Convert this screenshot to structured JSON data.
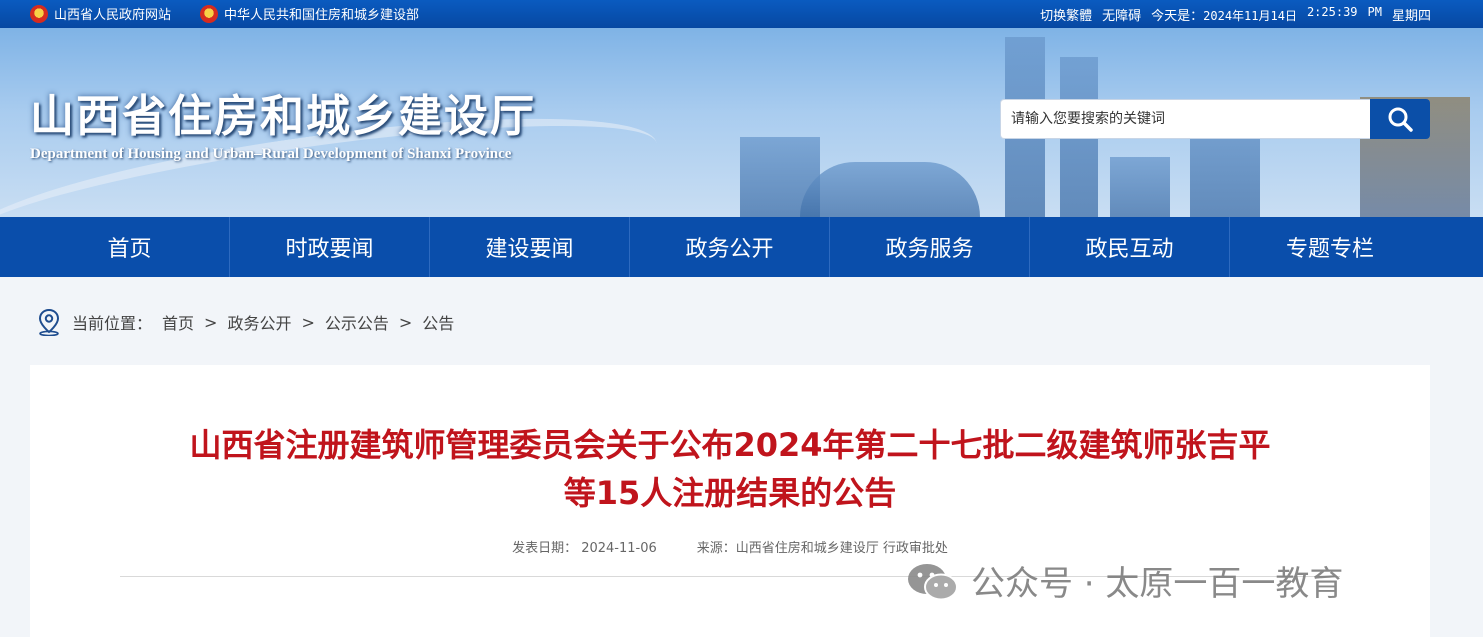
{
  "topbar": {
    "links": [
      "山西省人民政府网站",
      "中华人民共和国住房和城乡建设部"
    ],
    "toggle_traditional": "切换繁體",
    "accessibility": "无障碍",
    "today_label": "今天是：",
    "date": "2024年11月14日",
    "time": "2:25:39",
    "ampm": "PM",
    "weekday": "星期四"
  },
  "banner": {
    "title": "山西省住房和城乡建设厅",
    "subtitle_en": "Department of Housing and Urban–Rural Development of Shanxi Province"
  },
  "search": {
    "placeholder": "请输入您要搜索的关键词",
    "icon": "search-icon"
  },
  "nav": {
    "items": [
      "首页",
      "时政要闻",
      "建设要闻",
      "政务公开",
      "政务服务",
      "政民互动",
      "专题专栏"
    ]
  },
  "breadcrumb": {
    "label": "当前位置：",
    "items": [
      "首页",
      "政务公开",
      "公示公告",
      "公告"
    ]
  },
  "article": {
    "title_line1": "山西省注册建筑师管理委员会关于公布2024年第二十七批二级建筑师张吉平",
    "title_line2": "等15人注册结果的公告",
    "date_label": "发表日期：",
    "date": "2024-11-06",
    "source_label": "来源：",
    "source": "山西省住房和城乡建设厅 行政审批处"
  },
  "watermark": {
    "text": "公众号 · 太原一百一教育"
  },
  "colors": {
    "primary_blue": "#0a4eab",
    "title_red": "#c0141c"
  }
}
